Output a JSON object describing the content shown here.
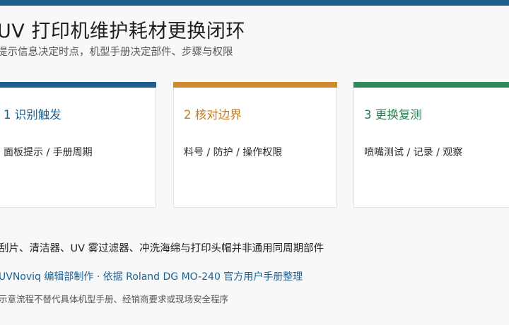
{
  "colors": {
    "top_bar": "#1f5f8e",
    "step1": "#1f5f8e",
    "step2": "#d08a2e",
    "step3": "#2e8b57",
    "credit": "#1f5f8e"
  },
  "title": "UV 打印机维护耗材更换闭环",
  "subtitle": "提示信息决定时点，机型手册决定部件、步骤与权限",
  "steps": [
    {
      "heading": "1  识别触发",
      "body": "面板提示 / 手册周期",
      "accent": "#1f5f8e"
    },
    {
      "heading": "2  核对边界",
      "body": "料号 / 防护 / 操作权限",
      "accent": "#d08a2e"
    },
    {
      "heading": "3  更换复测",
      "body": "喷嘴测试 / 记录 / 观察",
      "accent": "#2e8b57"
    }
  ],
  "note": "刮片、清洁器、UV 雾过滤器、冲洗海绵与打印头帽并非通用同周期部件",
  "credit": "UVNoviq 编辑部制作 · 依据 Roland DG MO-240 官方用户手册整理",
  "disclaimer": "示意流程不替代具体机型手册、经销商要求或现场安全程序"
}
